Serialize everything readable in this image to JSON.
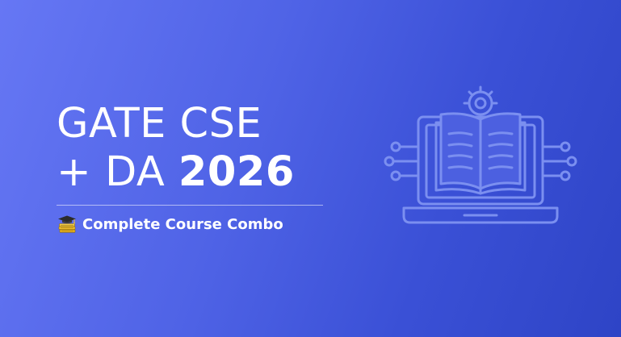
{
  "banner": {
    "title_line1": "GATE CSE",
    "title_line2_prefix": "+ DA ",
    "title_line2_year": "2026",
    "subtitle": "Complete Course Combo",
    "subtitle_icon": "graduation-cap-books-icon",
    "illustration_icon": "laptop-book-circuit-icon",
    "colors": {
      "background_start": "#6677f4",
      "background_end": "#2e44c6",
      "text": "#ffffff",
      "illustration": "#7b8ff0",
      "badge_gold": "#f2c230"
    }
  }
}
